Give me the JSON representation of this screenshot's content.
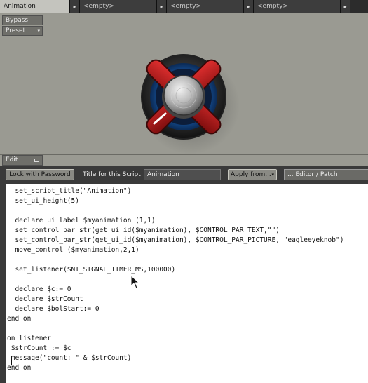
{
  "tabs": [
    {
      "label": "Animation",
      "active": true
    },
    {
      "label": "<empty>",
      "active": false
    },
    {
      "label": "<empty>",
      "active": false
    },
    {
      "label": "<empty>",
      "active": false
    }
  ],
  "tab_arrow_icon": "chevron-right",
  "panel": {
    "bypass_label": "Bypass",
    "preset_label": "Preset",
    "knob_icon": "eagle-eye-knob"
  },
  "edit_tab": {
    "label": "Edit"
  },
  "toolbar": {
    "lock_label": "Lock with Password",
    "title_label": "Title for this Script",
    "title_value": "Animation",
    "apply_label": "Apply from...",
    "editor_label": "... Editor / Patch"
  },
  "code_lines": [
    "  set_script_title(\"Animation\")",
    "  set_ui_height(5)",
    "",
    "  declare ui_label $myanimation (1,1)",
    "  set_control_par_str(get_ui_id($myanimation), $CONTROL_PAR_TEXT,\"\")",
    "  set_control_par_str(get_ui_id($myanimation), $CONTROL_PAR_PICTURE, \"eagleeyeknob\")",
    "  move_control ($myanimation,2,1)",
    "",
    "  set_listener($NI_SIGNAL_TIMER_MS,100000)",
    "",
    "  declare $c:= 0",
    "  declare $strCount",
    "  declare $bolStart:= 0",
    "end on",
    "",
    "on listener",
    " $strCount := $c",
    " message(\"count: \" & $strCount)",
    "end on"
  ],
  "colors": {
    "panel_bg": "#9a9a92",
    "knob_red": "#c41818",
    "knob_blue": "#1a5fb0"
  }
}
